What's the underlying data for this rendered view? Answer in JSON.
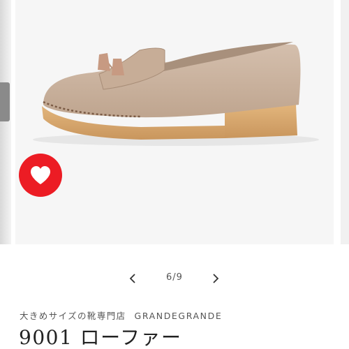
{
  "gallery": {
    "image_alt": "loafer-product-photo",
    "counter": "6/9",
    "prev_icon": "chevron-left-icon",
    "next_icon": "chevron-right-icon",
    "favorite_icon": "heart-icon",
    "favorite_color": "#ec1c24"
  },
  "product": {
    "shop_name": "大きめサイズの靴専門店",
    "brand": "GRANDEGRANDE",
    "title": "9001 ローファー"
  },
  "colors": {
    "shoe_upper": "#c9b19c",
    "sole": "#d9ab72",
    "text_primary": "#222222",
    "text_secondary": "#555555"
  }
}
